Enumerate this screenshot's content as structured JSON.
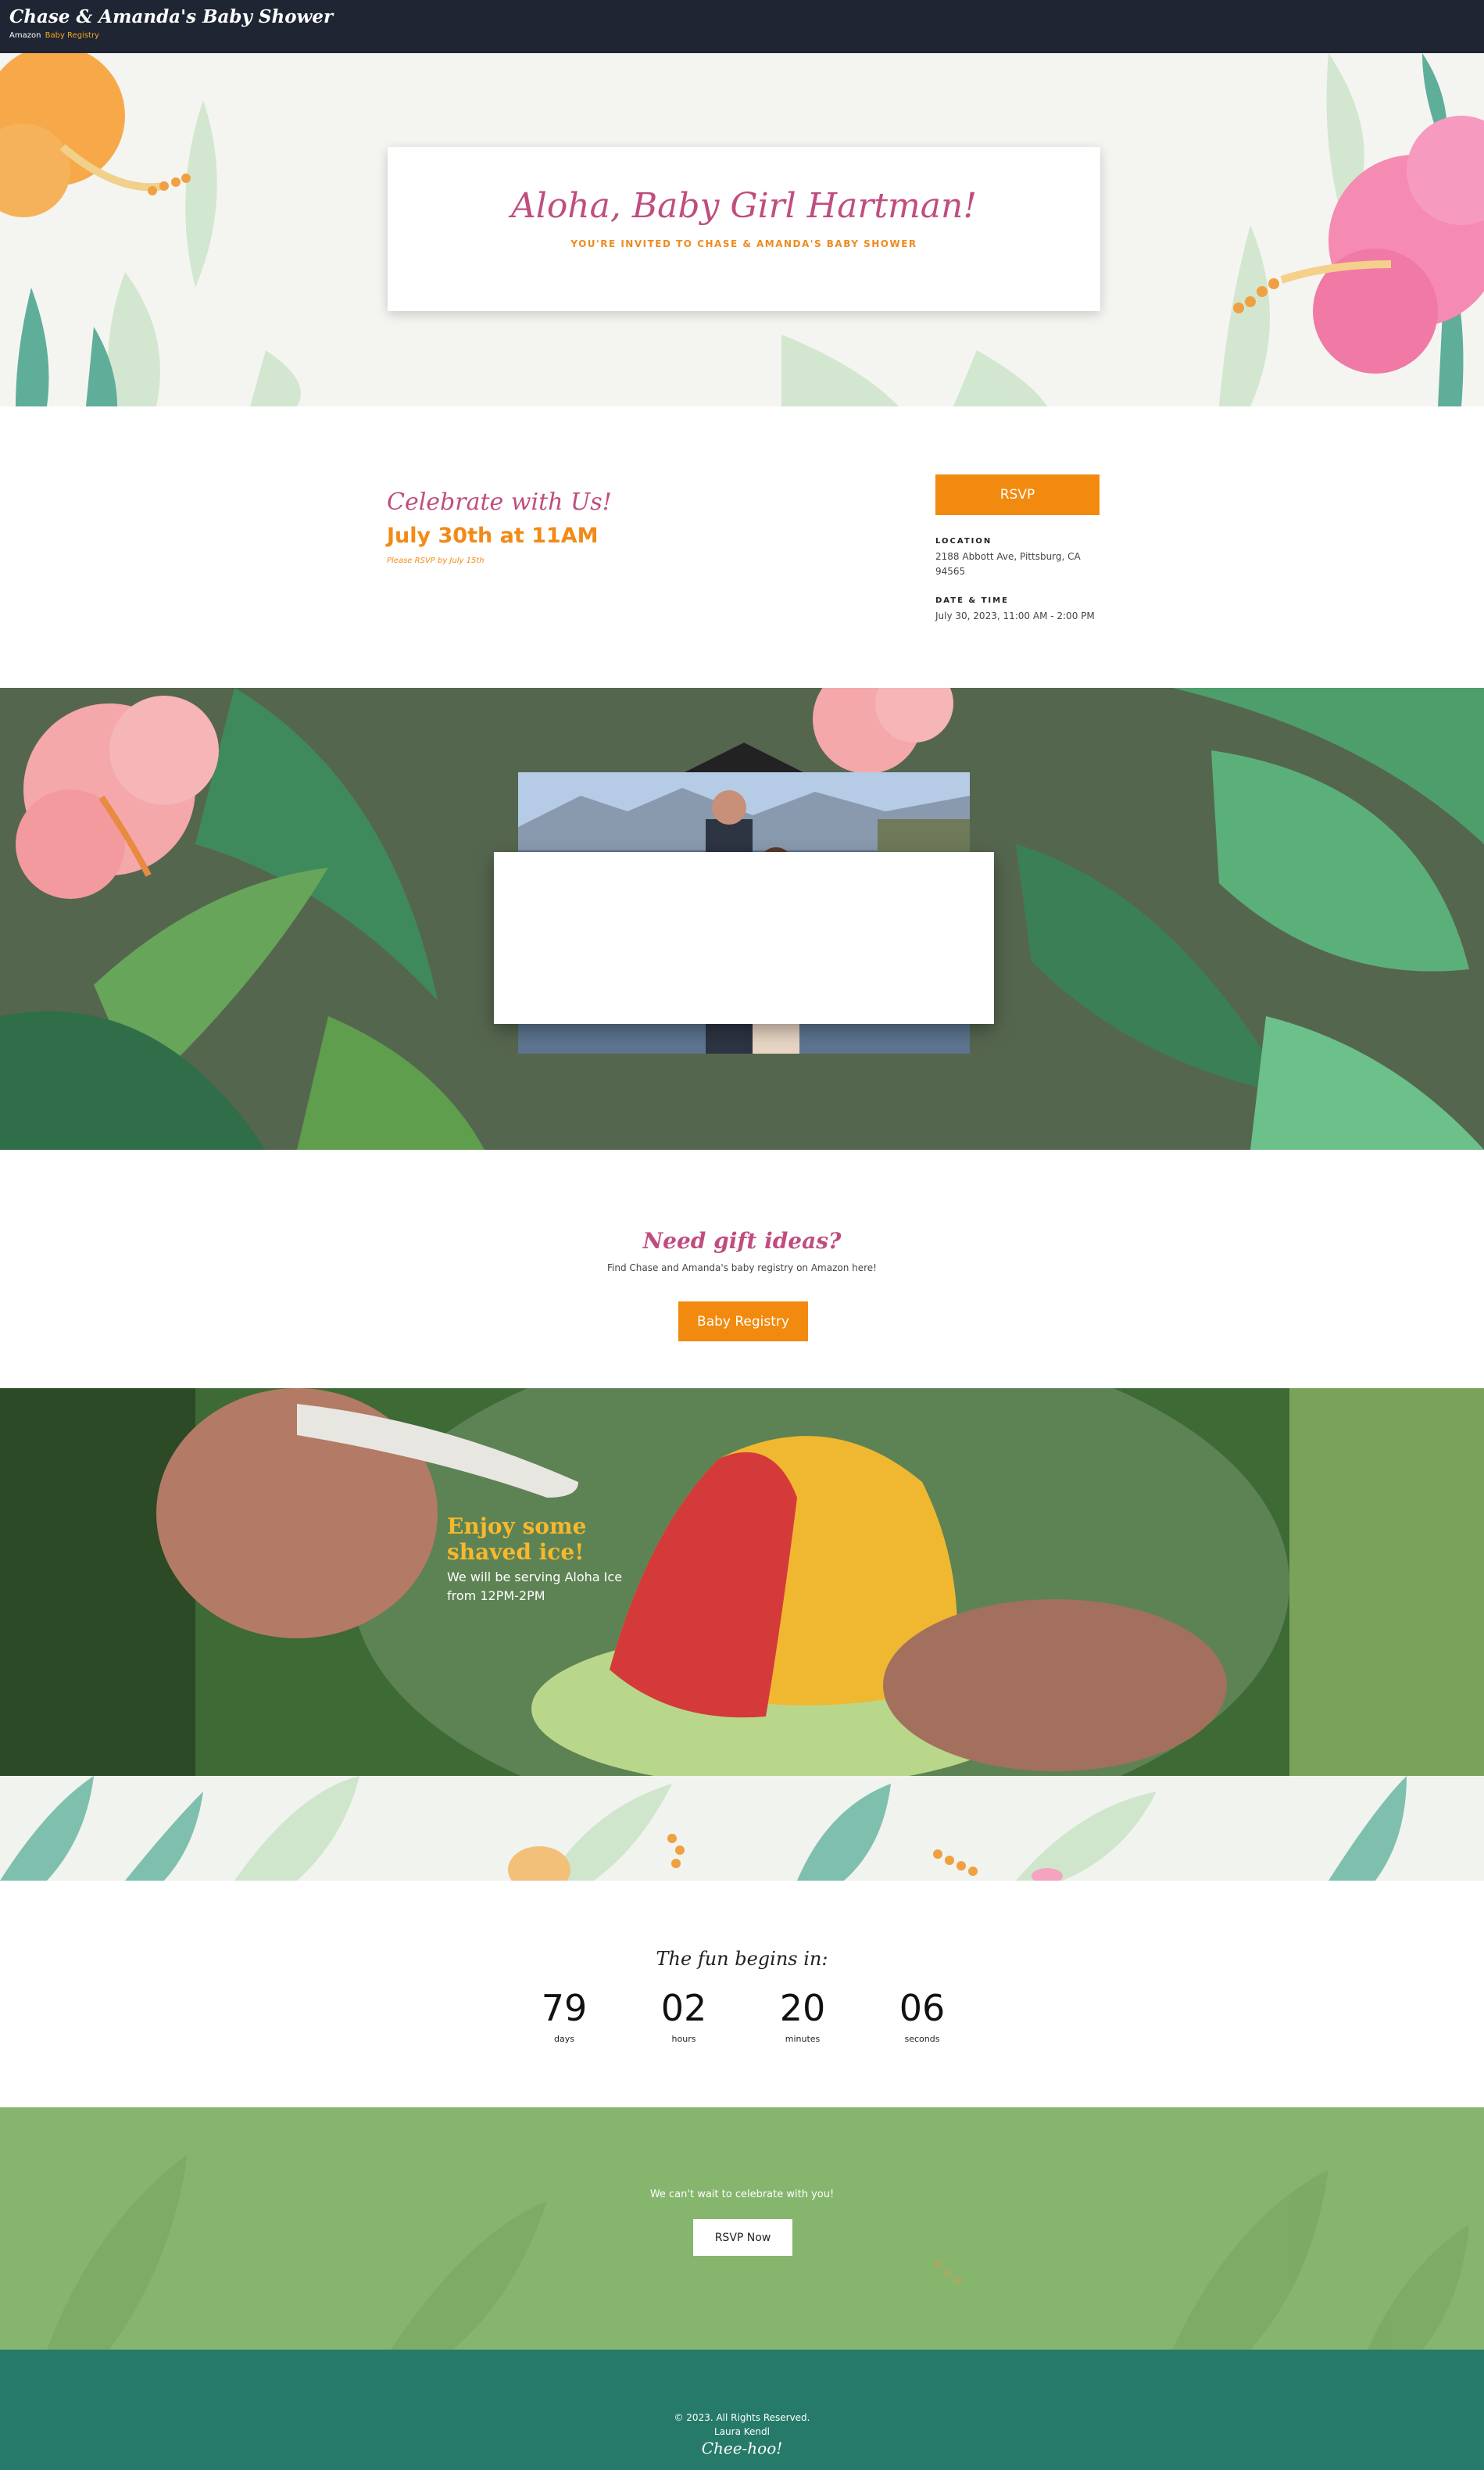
{
  "header": {
    "brand": "Chase & Amanda's Baby Shower",
    "sub_prefix": "Amazon",
    "sub_link": "Baby Registry"
  },
  "hero": {
    "title": "Aloha, Baby Girl Hartman!",
    "subtitle": "YOU'RE INVITED TO CHASE & AMANDA'S BABY SHOWER"
  },
  "celebrate": {
    "title": "Celebrate with Us!",
    "date": "July 30th at 11AM",
    "note": "Please RSVP by July 15th",
    "rsvp_label": "RSVP",
    "location_label": "LOCATION",
    "location_value": "2188 Abbott Ave, Pittsburg, CA 94565",
    "datetime_label": "DATE & TIME",
    "datetime_value": "July 30, 2023, 11:00 AM - 2:00 PM"
  },
  "gift": {
    "title": "Need gift ideas?",
    "text": "Find Chase and Amanda's baby registry on Amazon here!",
    "button": "Baby Registry"
  },
  "ice": {
    "title_line1": "Enjoy some",
    "title_line2": "shaved ice!",
    "text": "We will be serving Aloha Ice from 12PM-2PM"
  },
  "countdown": {
    "title": "The fun begins in:",
    "items": [
      {
        "value": "79",
        "label": "days"
      },
      {
        "value": "02",
        "label": "hours"
      },
      {
        "value": "20",
        "label": "minutes"
      },
      {
        "value": "06",
        "label": "seconds"
      }
    ]
  },
  "cta": {
    "text": "We can't wait to celebrate with you!",
    "button": "RSVP Now"
  },
  "footer": {
    "copyright": "© 2023. All Rights Reserved.",
    "author": "Laura Kendl",
    "signoff": "Chee-hoo!"
  },
  "colors": {
    "header_bg": "#1f2533",
    "accent_orange": "#f28a0f",
    "accent_pink": "#c04d7f",
    "cta_green": "#86b56d",
    "footer_teal": "#267a69"
  }
}
